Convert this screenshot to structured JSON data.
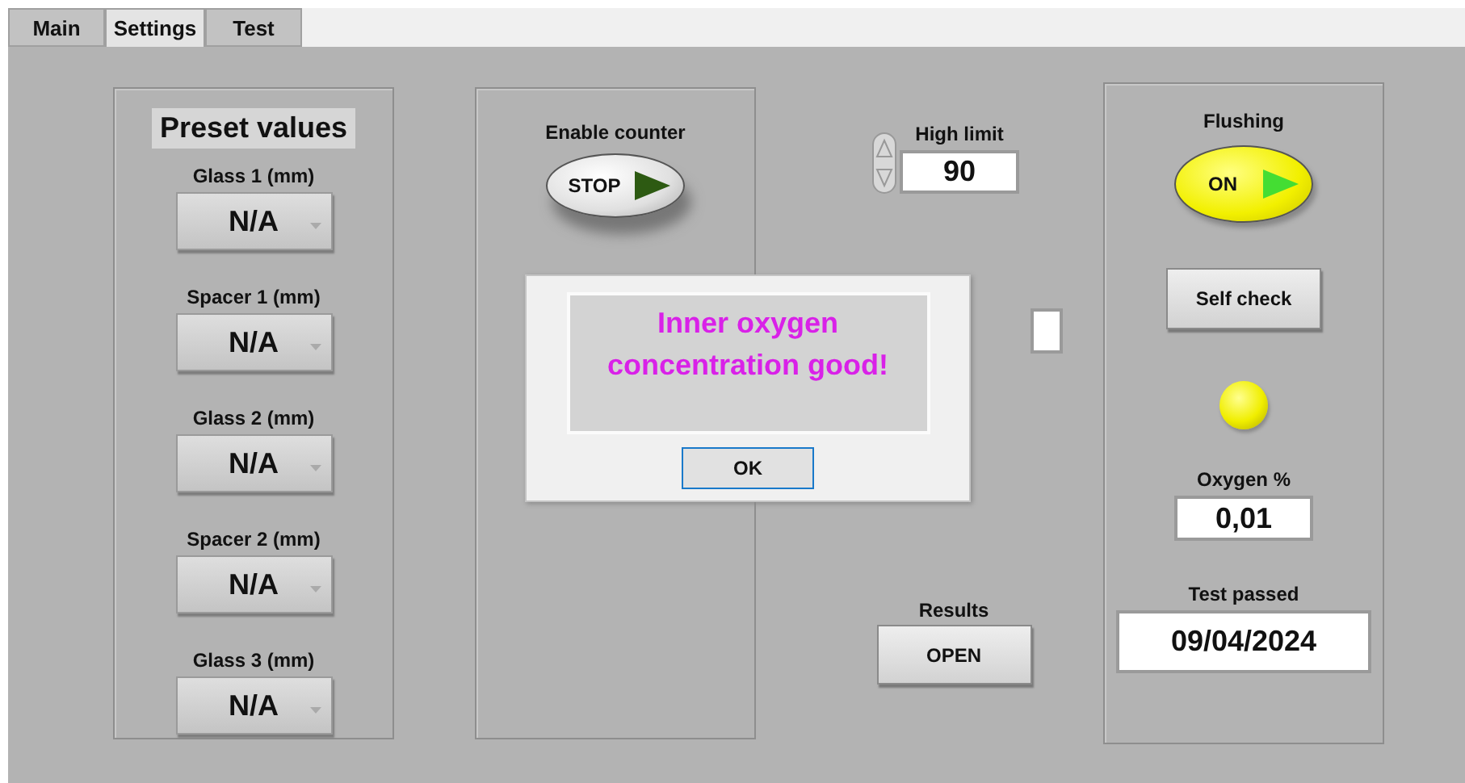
{
  "tabs": [
    {
      "label": "Main",
      "selected": false
    },
    {
      "label": "Settings",
      "selected": true
    },
    {
      "label": "Test",
      "selected": false
    }
  ],
  "preset": {
    "title": "Preset values",
    "fields": [
      {
        "label": "Glass 1 (mm)",
        "value": "N/A"
      },
      {
        "label": "Spacer 1 (mm)",
        "value": "N/A"
      },
      {
        "label": "Glass 2 (mm)",
        "value": "N/A"
      },
      {
        "label": "Spacer 2 (mm)",
        "value": "N/A"
      },
      {
        "label": "Glass 3 (mm)",
        "value": "N/A"
      }
    ]
  },
  "counter": {
    "label": "Enable counter",
    "switch": {
      "text": "STOP",
      "on": false
    }
  },
  "high_limit": {
    "label": "High limit",
    "value": "90"
  },
  "results": {
    "label": "Results",
    "button": "OPEN"
  },
  "flushing": {
    "label": "Flushing",
    "switch": {
      "text": "ON",
      "on": true
    }
  },
  "self_check": {
    "button": "Self check",
    "lit": true
  },
  "oxygen": {
    "label": "Oxygen %",
    "value": "0,01"
  },
  "test_passed": {
    "label": "Test passed",
    "value": "09/04/2024"
  },
  "dialog": {
    "message": "Inner oxygen concentration good!",
    "button": "OK"
  }
}
